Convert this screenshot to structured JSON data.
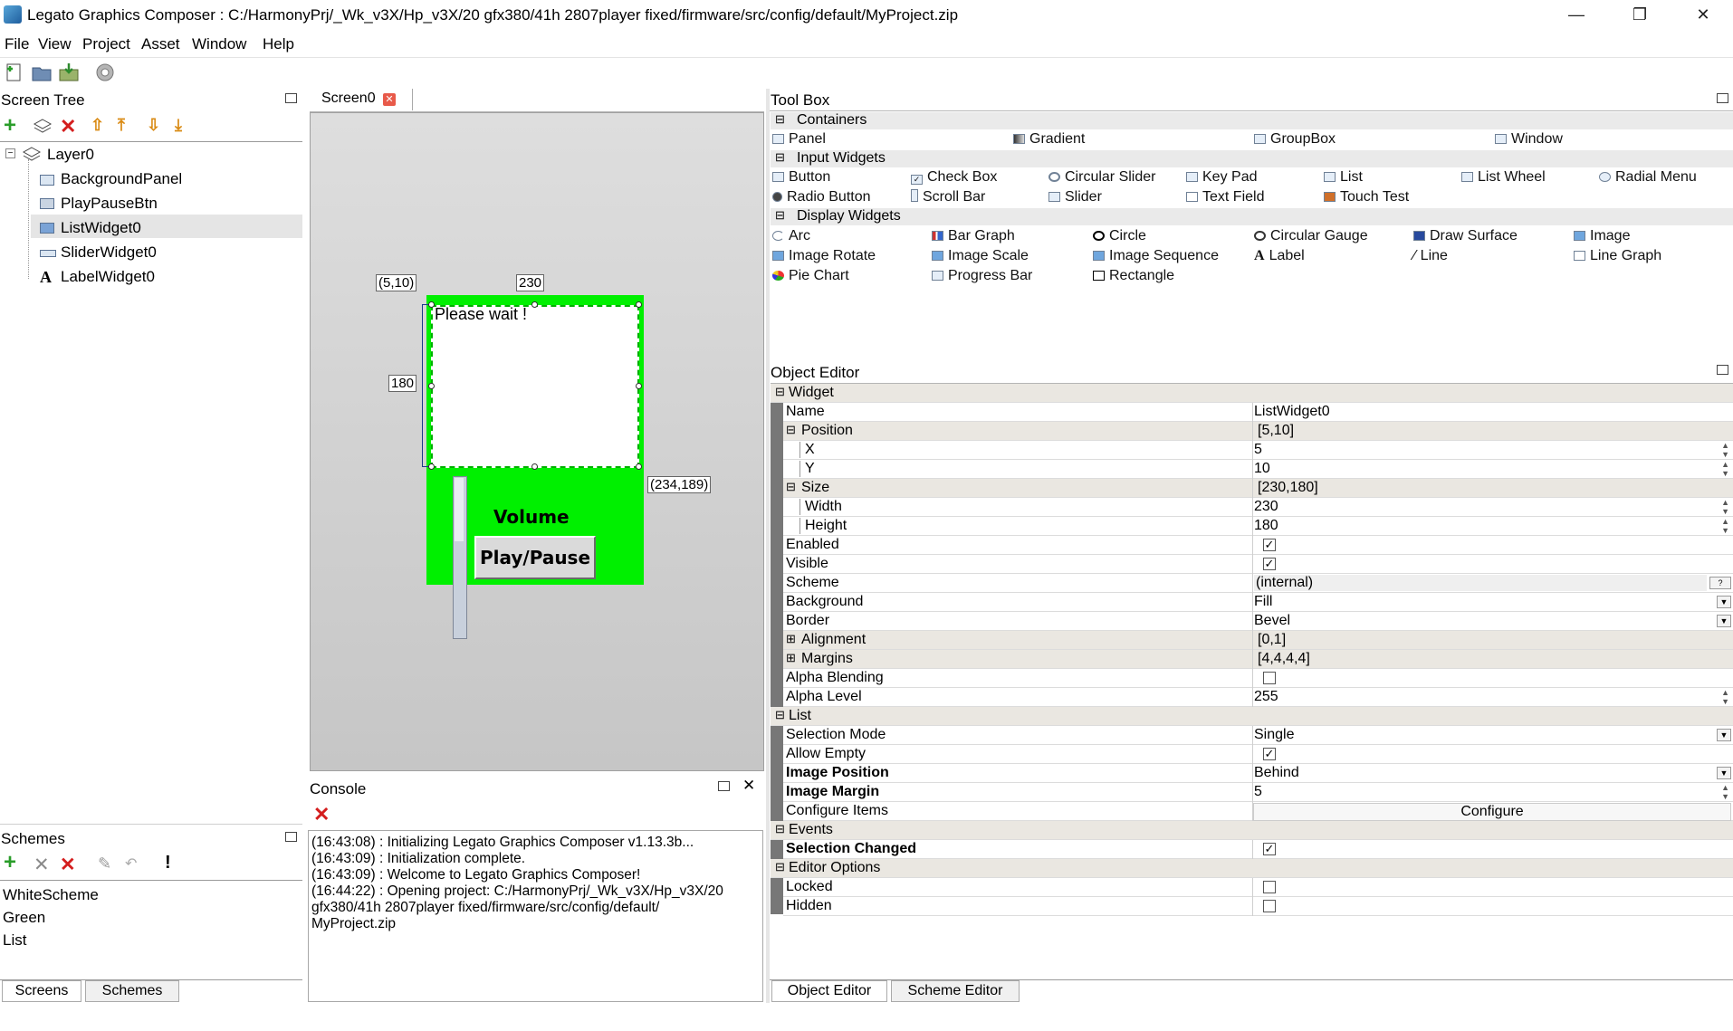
{
  "window": {
    "title": "Legato Graphics Composer : C:/HarmonyPrj/_Wk_v3X/Hp_v3X/20 gfx380/41h 2807player fixed/firmware/src/config/default/MyProject.zip",
    "minimize": "—",
    "restore": "❐",
    "close": "✕"
  },
  "menu": [
    "File",
    "View",
    "Project",
    "Asset",
    "Window",
    "Help"
  ],
  "screen_tree": {
    "title": "Screen Tree",
    "layer": "Layer0",
    "items": [
      "BackgroundPanel",
      "PlayPauseBtn",
      "ListWidget0",
      "SliderWidget0",
      "LabelWidget0"
    ],
    "selected": "ListWidget0"
  },
  "schemes": {
    "title": "Schemes",
    "items": [
      "WhiteScheme",
      "Green",
      "List"
    ]
  },
  "left_tabs": [
    "Screens",
    "Schemes"
  ],
  "canvas": {
    "tab": "Screen0",
    "pos_label": "(5,10)",
    "width_label": "230",
    "height_label": "180",
    "end_label": "(234,189)",
    "list_text": "Please wait !",
    "volume_label": "Volume",
    "button_label": "Play/Pause"
  },
  "console": {
    "title": "Console",
    "lines": [
      "(16:43:08) : Initializing Legato Graphics Composer v1.13.3b...",
      "(16:43:09) : Initialization complete.",
      "(16:43:09) : Welcome to Legato Graphics Composer!",
      "(16:44:22) : Opening project: C:/HarmonyPrj/_Wk_v3X/Hp_v3X/20",
      "gfx380/41h 2807player fixed/firmware/src/config/default/",
      "MyProject.zip"
    ]
  },
  "toolbox": {
    "title": "Tool Box",
    "sections": {
      "containers": "Containers",
      "input": "Input Widgets",
      "display": "Display Widgets"
    },
    "containers": [
      "Panel",
      "Gradient",
      "GroupBox",
      "Window"
    ],
    "input": [
      "Button",
      "Check Box",
      "Circular Slider",
      "Key Pad",
      "List",
      "List Wheel",
      "Radial Menu",
      "Radio Button",
      "Scroll Bar",
      "Slider",
      "Text Field",
      "Touch Test"
    ],
    "display": [
      "Arc",
      "Bar Graph",
      "Circle",
      "Circular Gauge",
      "Draw Surface",
      "Image",
      "Image Rotate",
      "Image Scale",
      "Image Sequence",
      "Label",
      "Line",
      "Line Graph",
      "Pie Chart",
      "Progress Bar",
      "Rectangle"
    ]
  },
  "object_editor": {
    "title": "Object Editor",
    "widget_section": "Widget",
    "name_label": "Name",
    "name_value": "ListWidget0",
    "position_label": "Position",
    "position_value": "[5,10]",
    "x_label": "X",
    "x_value": "5",
    "y_label": "Y",
    "y_value": "10",
    "size_label": "Size",
    "size_value": "[230,180]",
    "width_label": "Width",
    "width_value": "230",
    "height_label": "Height",
    "height_value": "180",
    "enabled_label": "Enabled",
    "visible_label": "Visible",
    "scheme_label": "Scheme",
    "scheme_value": "(internal)",
    "background_label": "Background",
    "background_value": "Fill",
    "border_label": "Border",
    "border_value": "Bevel",
    "alignment_label": "Alignment",
    "alignment_value": "[0,1]",
    "margins_label": "Margins",
    "margins_value": "[4,4,4,4]",
    "alpha_blending_label": "Alpha Blending",
    "alpha_level_label": "Alpha Level",
    "alpha_level_value": "255",
    "list_section": "List",
    "selection_mode_label": "Selection Mode",
    "selection_mode_value": "Single",
    "allow_empty_label": "Allow Empty",
    "image_position_label": "Image Position",
    "image_position_value": "Behind",
    "image_margin_label": "Image Margin",
    "image_margin_value": "5",
    "configure_items_label": "Configure Items",
    "configure_button": "Configure",
    "events_section": "Events",
    "selection_changed_label": "Selection Changed",
    "editor_options_section": "Editor Options",
    "locked_label": "Locked",
    "hidden_label": "Hidden",
    "scheme_help": "?"
  },
  "right_tabs": [
    "Object Editor",
    "Scheme Editor"
  ]
}
